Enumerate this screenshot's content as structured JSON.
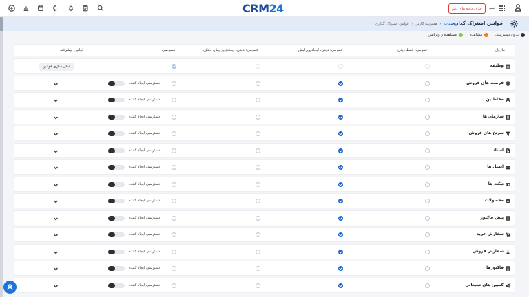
{
  "topbar": {
    "logo_crm": "CRM",
    "logo_num": "24",
    "demo_button": "حذف داده های دمو",
    "user_name": "سو"
  },
  "header": {
    "title": "قوانین اشتراک گذاری",
    "crumbs": [
      "تنظیمات",
      "مدیریت کاربر",
      "قوانین اشتراک گذاری"
    ]
  },
  "legend": [
    {
      "label": "بدون دسترسی",
      "color": "#2b2f36"
    },
    {
      "label": "مشاهده",
      "color": "#f57c00"
    },
    {
      "label": "مشاهده و ویرایش",
      "color": "#8bc34a"
    }
  ],
  "table": {
    "columns": {
      "module": "ماژول",
      "view_only": "عمومی: فقط دیدن",
      "view_create_edit": "عمومی: دیدن، ایجاد/ویرایش",
      "view_create_edit_delete": "عمومی: دیدن، ایجاد/ویرایش، حذف",
      "private": "خصوصی",
      "advanced": "قوانین پیشرفته"
    },
    "creator_access_label": "دسترسی ایجاد کننده",
    "activate_rules_label": "فعال سازی قوانین",
    "rows": [
      {
        "label": "وظیفه",
        "icon": "calendar-icon",
        "selected": "private"
      },
      {
        "label": "فرصت های فروش",
        "icon": "target-icon",
        "selected": "view_create_edit"
      },
      {
        "label": "مخاطبین",
        "icon": "person-icon",
        "selected": "view_create_edit"
      },
      {
        "label": "سازمان ها",
        "icon": "building-icon",
        "selected": "view_create_edit"
      },
      {
        "label": "سرنخ های فروش",
        "icon": "funnel-icon",
        "selected": "view_create_edit"
      },
      {
        "label": "اسناد",
        "icon": "document-icon",
        "selected": "view_create_edit"
      },
      {
        "label": "ایمیل ها",
        "icon": "mail-icon",
        "selected": "view_create_edit"
      },
      {
        "label": "تیکت ها",
        "icon": "ticket-icon",
        "selected": "view_create_edit"
      },
      {
        "label": "محصولات",
        "icon": "box-icon",
        "selected": "view_create_edit"
      },
      {
        "label": "پیش فاکتور",
        "icon": "invoice-icon",
        "selected": "view_create_edit"
      },
      {
        "label": "سفارش خرید",
        "icon": "cart-icon",
        "selected": "view_create_edit"
      },
      {
        "label": "سفارش فروش",
        "icon": "sale-icon",
        "selected": "view_create_edit"
      },
      {
        "label": "فاکتورها",
        "icon": "receipt-icon",
        "selected": "view_create_edit"
      },
      {
        "label": "کمپین های تبلیغاتی",
        "icon": "megaphone-icon",
        "selected": "view_create_edit"
      }
    ]
  }
}
